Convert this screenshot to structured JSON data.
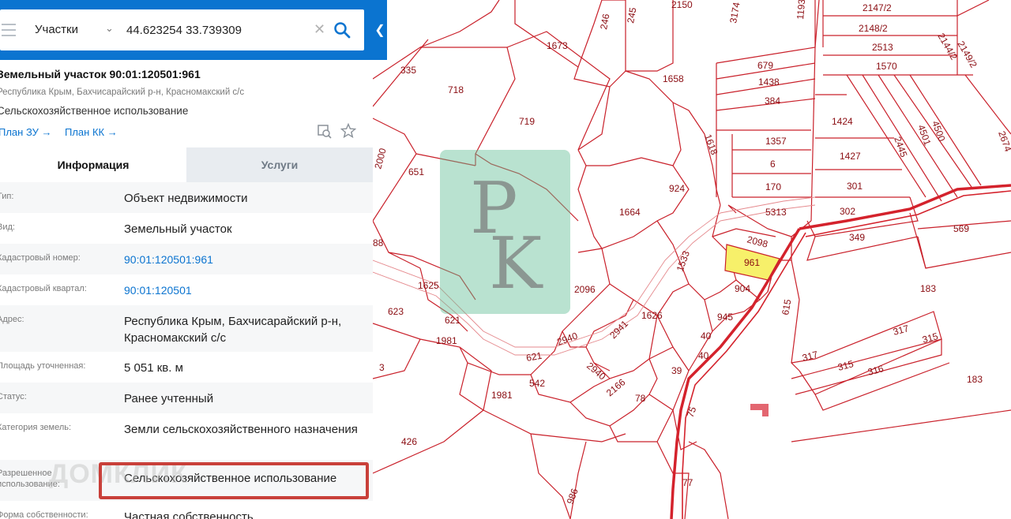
{
  "search": {
    "type": "Участки",
    "value": "44.623254 33.739309"
  },
  "plot": {
    "title": "Земельный участок 90:01:120501:961",
    "address": "Республика Крым, Бахчисарайский р-н, Красномакский с/с",
    "use": "Сельскохозяйственное использование",
    "plan_zu": "План ЗУ →",
    "plan_kk": "План КК →"
  },
  "tabs": [
    "Информация",
    "Услуги"
  ],
  "rows": [
    {
      "key": "Тип:",
      "value": "Объект недвижимости"
    },
    {
      "key": "Вид:",
      "value": "Земельный участок"
    },
    {
      "key": "Кадастровый номер:",
      "value": "90:01:120501:961"
    },
    {
      "key": "Кадастровый квартал:",
      "value": "90:01:120501"
    },
    {
      "key": "Адрес:",
      "value": "Республика Крым, Бахчисарайский р-н, Красномакский с/с"
    },
    {
      "key": "Площадь уточненная:",
      "value": "5 051 кв. м"
    },
    {
      "key": "Статус:",
      "value": "Ранее учтенный"
    },
    {
      "key": "Категория земель:",
      "value": "Земли сельскохозяйственного назначения"
    },
    {
      "key": "Разрешенное использование:",
      "value": "Сельскохозяйственное использование"
    },
    {
      "key": "Форма собственности:",
      "value": "Частная собственность"
    }
  ],
  "watermark": "ДОМКЛИК",
  "map": {
    "highlighted_plot": "961",
    "plots": [
      "2150",
      "3174",
      "1193",
      "2147/2",
      "2148/2",
      "2149/2",
      "2144/2",
      "2513",
      "1570",
      "246",
      "245",
      "1673",
      "679",
      "1438",
      "384",
      "335",
      "718",
      "1658",
      "719",
      "1424",
      "2445",
      "4501",
      "4500",
      "2674",
      "1357",
      "6",
      "1427",
      "1618",
      "2000",
      "651",
      "924",
      "170",
      "301",
      "5313",
      "302",
      "1664",
      "2098",
      "349",
      "569",
      "88",
      "961",
      "1533",
      "1625",
      "904",
      "183",
      "623",
      "2096",
      "615",
      "945",
      "1626",
      "621",
      "2941",
      "40",
      "317",
      "315",
      "1981",
      "2940",
      "621",
      "39",
      "317",
      "315",
      "3",
      "40",
      "316",
      "542",
      "2940",
      "183",
      "2166",
      "1981",
      "78",
      "75",
      "426",
      "77",
      "986"
    ]
  },
  "colors": {
    "accent": "#0b74d0",
    "plot_line": "#c9202a",
    "highlight_fill": "#f7f06a",
    "callout": "#c9403a"
  }
}
